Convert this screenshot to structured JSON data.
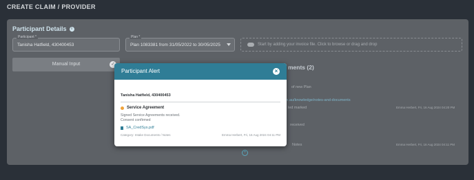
{
  "page": {
    "title": "CREATE CLAIM / PROVIDER"
  },
  "participant_details": {
    "title": "Participant Details",
    "participant_label": "Participant *",
    "participant_value": "Tanisha Hatfield, 430400453",
    "plan_label": "Plan *",
    "plan_value": "Plan 1083381 from 31/05/2022 to 30/05/2025",
    "dropzone_text": "Start by adding your invoice file. Click to browse or drag and drop"
  },
  "background": {
    "manual_input_label": "Manual Input",
    "docs_title_suffix": "ments (2)",
    "line1": "of new Plan",
    "line2": "com.au/knowledge/notes-and-documents",
    "line3": "led marked",
    "line4": "received",
    "line5": "Notes",
    "ts1": "Emma Herbert, Fri, 16 Aug 2024 04:20 PM",
    "ts2": "Emma Herbert, Fri, 16 Aug 2024 04:11 PM"
  },
  "modal": {
    "title": "Participant Alert",
    "participant": "Tanisha Hatfield, 430400453",
    "alert_title": "Service Agreement",
    "alert_status_color": "#f0a33a",
    "body_line1": "Signed Service Agreements received.",
    "body_line2": "Consent confirmed",
    "file_name": "SA_CredSys.pdf",
    "category": "Category: Intake Documents / Notes",
    "author_time": "Emma Herbert, Fri, 16 Aug 2024 04:11 PM"
  },
  "icons": {
    "info": "info-icon",
    "close": "close-icon",
    "cloud": "cloud-upload-icon",
    "check": "check-icon",
    "file": "file-icon"
  }
}
